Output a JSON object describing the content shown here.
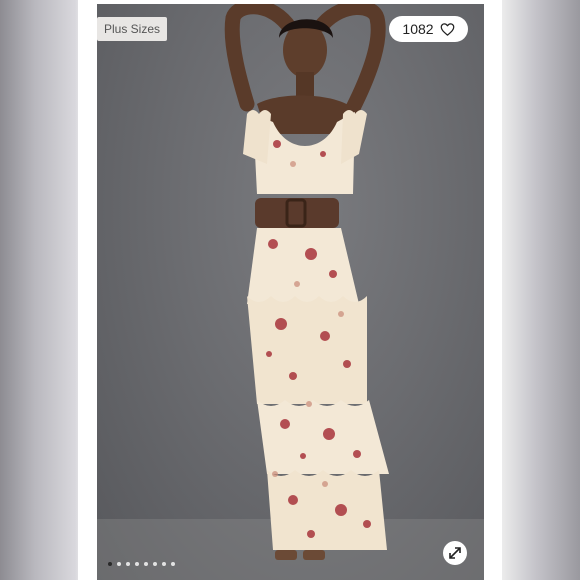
{
  "listing": {
    "tag_label": "Plus Sizes",
    "like_count": "1082",
    "like_icon": "heart-icon",
    "expand_icon": "expand-icon"
  },
  "carousel": {
    "dot_count": 8,
    "active_index": 0
  },
  "colors": {
    "backdrop": "#6b6c70",
    "dress": "#f3e8d6",
    "floral": "#a8343c",
    "belt": "#5a3a2c"
  }
}
